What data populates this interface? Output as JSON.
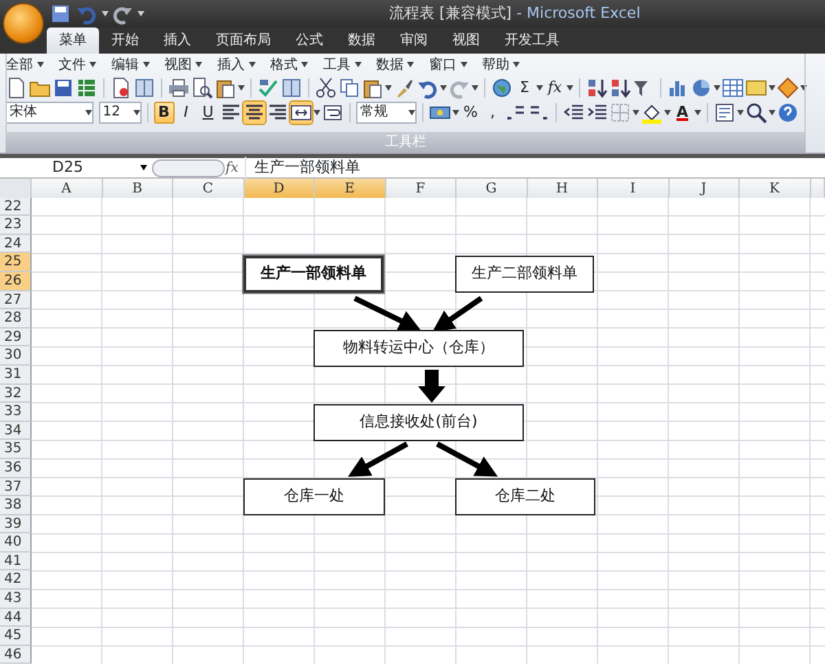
{
  "window": {
    "title": "流程表  [兼容模式]",
    "app_name": " - Microsoft Excel"
  },
  "ribbon_tabs": [
    {
      "label": "菜单",
      "selected": true
    },
    {
      "label": "开始",
      "selected": false
    },
    {
      "label": "插入",
      "selected": false
    },
    {
      "label": "页面布局",
      "selected": false
    },
    {
      "label": "公式",
      "selected": false
    },
    {
      "label": "数据",
      "selected": false
    },
    {
      "label": "审阅",
      "selected": false
    },
    {
      "label": "视图",
      "selected": false
    },
    {
      "label": "开发工具",
      "selected": false
    }
  ],
  "menu_bar": [
    "全部",
    "文件",
    "编辑",
    "视图",
    "插入",
    "格式",
    "工具",
    "数据",
    "窗口",
    "帮助"
  ],
  "toolbar": {
    "sum_button": "Σ",
    "function_button": "fx",
    "font": "宋体",
    "font_size": "12",
    "format_buttons": [
      {
        "label": "B",
        "pressed": true
      },
      {
        "label": "I",
        "pressed": false
      },
      {
        "label": "U",
        "pressed": false
      }
    ],
    "align_buttons": [
      {
        "pressed": false
      },
      {
        "pressed": true
      },
      {
        "pressed": false
      },
      {
        "pressed": true
      }
    ],
    "number_format": "常规",
    "percent_button": "%",
    "comma_button": ",",
    "font_color_button": "A",
    "group_label": "工具栏"
  },
  "formula_bar": {
    "name_box": "D25",
    "fx_label": "fx",
    "content": "生产一部领料单"
  },
  "sheet": {
    "columns": [
      {
        "label": "A",
        "selected": false
      },
      {
        "label": "B",
        "selected": false
      },
      {
        "label": "C",
        "selected": false
      },
      {
        "label": "D",
        "selected": true
      },
      {
        "label": "E",
        "selected": true
      },
      {
        "label": "F",
        "selected": false
      },
      {
        "label": "G",
        "selected": false
      },
      {
        "label": "H",
        "selected": false
      },
      {
        "label": "I",
        "selected": false
      },
      {
        "label": "J",
        "selected": false
      },
      {
        "label": "K",
        "selected": false
      }
    ],
    "rows": [
      {
        "label": "22",
        "selected": false
      },
      {
        "label": "23",
        "selected": false
      },
      {
        "label": "24",
        "selected": false
      },
      {
        "label": "25",
        "selected": true
      },
      {
        "label": "26",
        "selected": true
      },
      {
        "label": "27",
        "selected": false
      },
      {
        "label": "28",
        "selected": false
      },
      {
        "label": "29",
        "selected": false
      },
      {
        "label": "30",
        "selected": false
      },
      {
        "label": "31",
        "selected": false
      },
      {
        "label": "32",
        "selected": false
      },
      {
        "label": "33",
        "selected": false
      },
      {
        "label": "34",
        "selected": false
      },
      {
        "label": "35",
        "selected": false
      },
      {
        "label": "36",
        "selected": false
      },
      {
        "label": "37",
        "selected": false
      },
      {
        "label": "38",
        "selected": false
      },
      {
        "label": "39",
        "selected": false
      },
      {
        "label": "40",
        "selected": false
      },
      {
        "label": "41",
        "selected": false
      },
      {
        "label": "42",
        "selected": false
      },
      {
        "label": "43",
        "selected": false
      },
      {
        "label": "44",
        "selected": false
      },
      {
        "label": "45",
        "selected": false
      },
      {
        "label": "46",
        "selected": false
      }
    ]
  },
  "diagram": {
    "shapes": [
      {
        "text": "生产一部领料单",
        "bold": true,
        "selected": true
      },
      {
        "text": "生产二部领料单",
        "bold": false,
        "selected": false
      },
      {
        "text": "物料转运中心（仓库）",
        "bold": false,
        "selected": false
      },
      {
        "text": "信息接收处(前台)",
        "bold": false,
        "selected": false
      },
      {
        "text": "仓库一处",
        "bold": false,
        "selected": false
      },
      {
        "text": "仓库二处",
        "bold": false,
        "selected": false
      }
    ],
    "connectors": [
      {
        "kind": "line"
      },
      {
        "kind": "line"
      },
      {
        "kind": "block"
      },
      {
        "kind": "line"
      },
      {
        "kind": "line"
      }
    ]
  }
}
